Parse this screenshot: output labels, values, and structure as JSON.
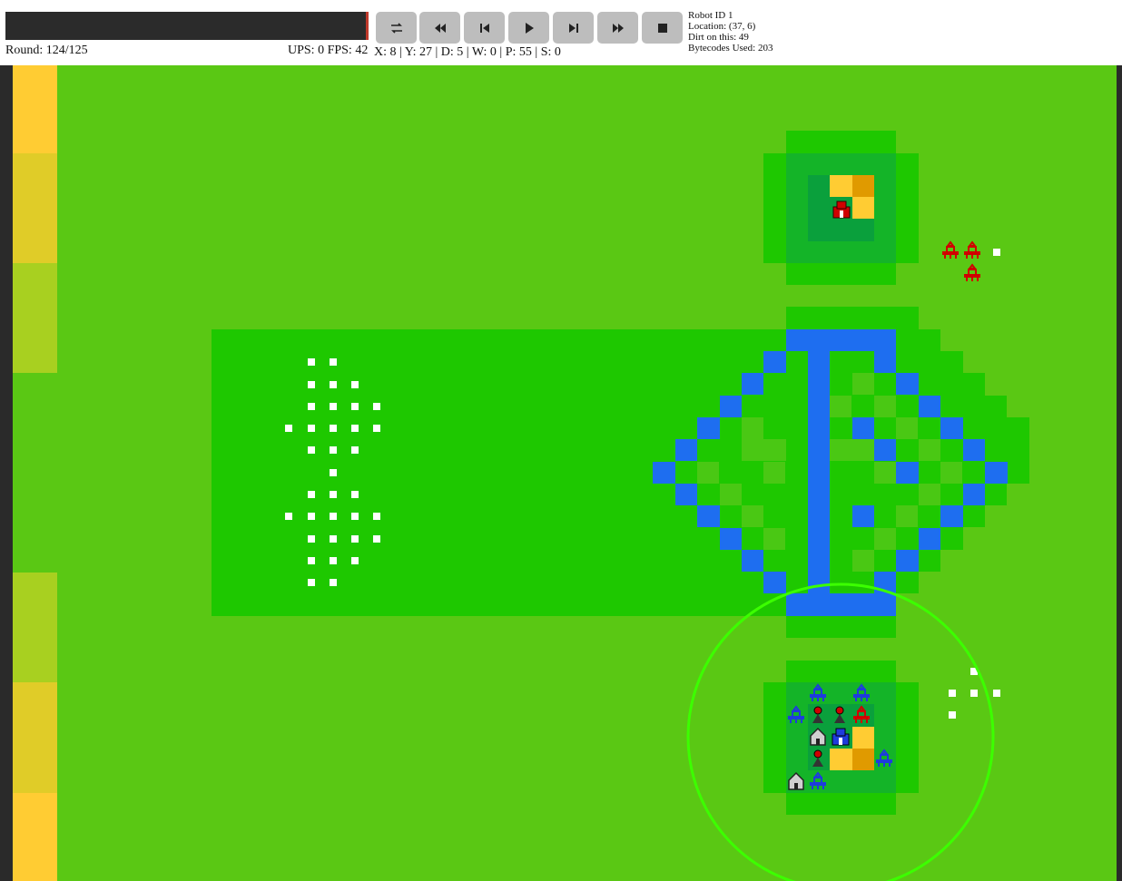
{
  "status": {
    "round": "Round: 124/125",
    "ups_fps": "UPS: 0 FPS: 42",
    "coords": "X: 8 | Y: 27 | D: 5 | W: 0 | P: 55 | S: 0"
  },
  "controls": [
    {
      "name": "toggle-button",
      "icon": "swap-icon"
    },
    {
      "name": "rewind-button",
      "icon": "fast-backward-icon"
    },
    {
      "name": "step-back-button",
      "icon": "skip-back-icon"
    },
    {
      "name": "play-button",
      "icon": "play-icon"
    },
    {
      "name": "step-forward-button",
      "icon": "skip-forward-icon"
    },
    {
      "name": "fast-forward-button",
      "icon": "fast-forward-icon"
    },
    {
      "name": "stop-button",
      "icon": "stop-icon"
    }
  ],
  "robot_info": {
    "id": "Robot ID 1",
    "location": "Location: (37, 6)",
    "dirt": "Dirt on this: 49",
    "bytecodes": "Bytecodes Used: 203"
  },
  "colors": {
    "field": "#5ac814",
    "field_dark": "#1ec800",
    "water": "#1e6ef0",
    "soup_light": "#ffcc33",
    "soup_dark": "#e09a00",
    "hq_dark": "#0aa03c",
    "team_red": "#d00000",
    "team_blue": "#1e3cdc",
    "selection": "#3cff00"
  }
}
